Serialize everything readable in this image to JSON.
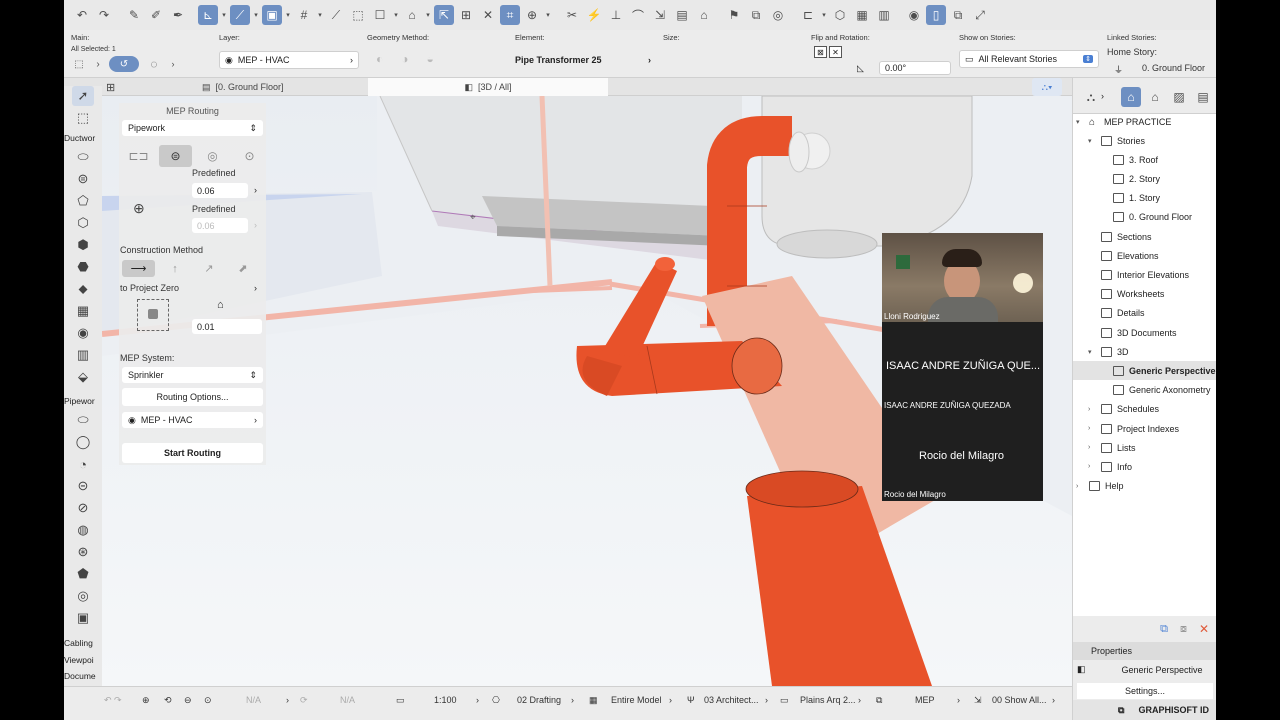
{
  "toolbar": {
    "icons": [
      "undo-icon",
      "redo-icon",
      "eyedropper-icon",
      "pencil-icon",
      "pen-icon",
      "snap-icon",
      "guide-icon",
      "grid-icon",
      "cursor-icon",
      "select-icon",
      "marquee-icon",
      "cross-icon",
      "transform-icon",
      "target-icon",
      "split-icon",
      "magic-wand-icon",
      "arrow-icon",
      "section-icon",
      "flag-icon",
      "camera-icon",
      "visual-icon",
      "3d-cube-icon",
      "view-icon",
      "layers-icon"
    ]
  },
  "infobox": {
    "main_label": "Main:",
    "main_value": "All Selected: 1",
    "layer_label": "Layer:",
    "layer_value": "MEP - HVAC",
    "geometry_label": "Geometry Method:",
    "element_label": "Element:",
    "element_value": "Pipe Transformer 25",
    "size_label": "Size:",
    "flip_label": "Flip and Rotation:",
    "rotation_value": "0.00°",
    "show_on_stories_label": "Show on Stories:",
    "show_on_stories_value": "All Relevant Stories",
    "linked_stories_label": "Linked Stories:",
    "home_story_label": "Home Story:",
    "home_story_value": "0. Ground Floor"
  },
  "tabs": {
    "floor": "[0. Ground Floor]",
    "view3d": "[3D / All]"
  },
  "toolbox": {
    "sections": [
      "Ductwor",
      "Pipewor",
      "Cabling",
      "Viewpoi",
      "Docume"
    ]
  },
  "routing": {
    "title": "MEP Routing",
    "domain": "Pipework",
    "predefined_1": "Predefined",
    "size_1": "0.06",
    "predefined_2": "Predefined",
    "size_2": "0.06",
    "construction_method": "Construction Method",
    "to_project_zero": "to Project Zero",
    "offset": "0.01",
    "mep_system_label": "MEP System:",
    "mep_system": "Sprinkler",
    "routing_options": "Routing Options...",
    "layer": "MEP - HVAC",
    "start_routing": "Start Routing"
  },
  "navigator": {
    "project": "MEP PRACTICE",
    "items": [
      {
        "label": "Stories",
        "indent": 1,
        "arrow": "▾"
      },
      {
        "label": "3. Roof",
        "indent": 2,
        "arrow": ""
      },
      {
        "label": "2. Story",
        "indent": 2,
        "arrow": ""
      },
      {
        "label": "1. Story",
        "indent": 2,
        "arrow": ""
      },
      {
        "label": "0. Ground Floor",
        "indent": 2,
        "arrow": ""
      },
      {
        "label": "Sections",
        "indent": 1,
        "arrow": ""
      },
      {
        "label": "Elevations",
        "indent": 1,
        "arrow": ""
      },
      {
        "label": "Interior Elevations",
        "indent": 1,
        "arrow": ""
      },
      {
        "label": "Worksheets",
        "indent": 1,
        "arrow": ""
      },
      {
        "label": "Details",
        "indent": 1,
        "arrow": ""
      },
      {
        "label": "3D Documents",
        "indent": 1,
        "arrow": ""
      },
      {
        "label": "3D",
        "indent": 1,
        "arrow": "▾"
      },
      {
        "label": "Generic Perspective",
        "indent": 2,
        "arrow": "",
        "selected": true
      },
      {
        "label": "Generic Axonometry",
        "indent": 2,
        "arrow": ""
      },
      {
        "label": "Schedules",
        "indent": 1,
        "arrow": "›"
      },
      {
        "label": "Project Indexes",
        "indent": 1,
        "arrow": "›"
      },
      {
        "label": "Lists",
        "indent": 1,
        "arrow": "›"
      },
      {
        "label": "Info",
        "indent": 1,
        "arrow": "›"
      },
      {
        "label": "Help",
        "indent": 0,
        "arrow": "›"
      }
    ]
  },
  "properties": {
    "title": "Properties",
    "view": "Generic Perspective",
    "settings": "Settings...",
    "brand": "GRAPHISOFT ID"
  },
  "statusbar": {
    "na1": "N/A",
    "na2": "N/A",
    "scale": "1:100",
    "layer_combo": "02 Drafting",
    "model_view": "Entire Model",
    "pen_set": "03 Architect...",
    "graphic_override": "Plains Arq 2...",
    "renovation": "MEP",
    "dimension": "00 Show All..."
  },
  "call": {
    "participant_1": "Lloni Rodriguez",
    "participant_2_tile": "ISAAC ANDRE ZUÑIGA QUE...",
    "participant_2_name": "ISAAC ANDRE ZUÑIGA QUEZADA",
    "participant_3_tile": "Rocio del Milagro",
    "participant_3_name": "Rocio del Milagro"
  },
  "colors": {
    "pipe": "#e8522a",
    "pipe_light": "#f0b8a4",
    "accent": "#6d8fc2"
  }
}
